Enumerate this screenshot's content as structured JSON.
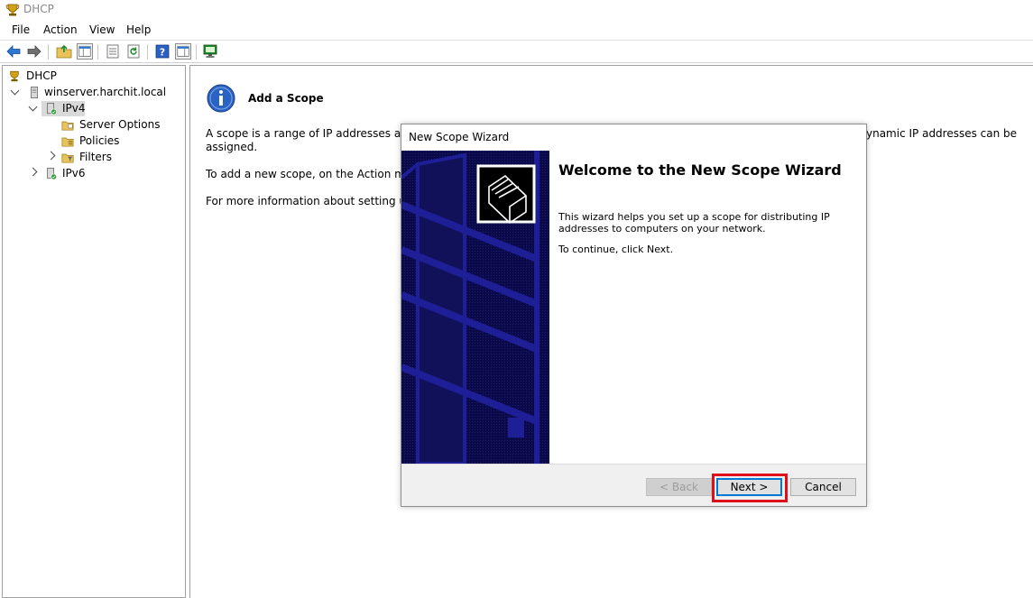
{
  "window": {
    "title": "DHCP"
  },
  "menu": {
    "items": [
      "File",
      "Action",
      "View",
      "Help"
    ]
  },
  "toolbar": {
    "icons": [
      "back-arrow-icon",
      "forward-arrow-icon",
      "up-folder-icon",
      "show-hide-tree-icon",
      "properties-icon",
      "refresh-icon",
      "help-icon",
      "action-pane-icon",
      "console-icon"
    ]
  },
  "tree": {
    "root": "DHCP",
    "server": "winserver.harchit.local",
    "ipv4": "IPv4",
    "server_options": "Server Options",
    "policies": "Policies",
    "filters": "Filters",
    "ipv6": "IPv6"
  },
  "content": {
    "heading": "Add a Scope",
    "para1_left": "A scope is a range of IP addresses assigne",
    "para1_right": "ynamic IP addresses can be",
    "para1_line2": "assigned.",
    "para2": "To add a new scope, on the Action menu,",
    "para3": "For more information about setting up a"
  },
  "wizard": {
    "title": "New Scope Wizard",
    "heading": "Welcome to the New Scope Wizard",
    "description": "This wizard helps you set up a scope for distributing IP addresses to computers on your network.",
    "continue_text": "To continue, click Next.",
    "buttons": {
      "back": "< Back",
      "next": "Next >",
      "cancel": "Cancel"
    }
  },
  "colors": {
    "banner": "#0a0a4a",
    "banner_stripe": "#1a1a8a",
    "highlight": "#e0101a",
    "info_icon": "#2b63c2"
  }
}
